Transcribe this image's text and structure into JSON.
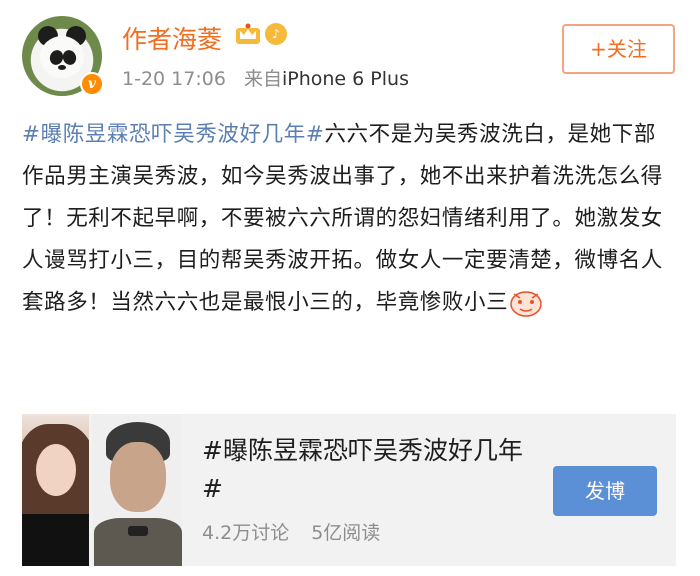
{
  "post": {
    "author": "作者海菱",
    "meta_time": "1-20 17:06",
    "meta_source_prefix": "来自",
    "meta_source": "iPhone 6 Plus",
    "follow_label": "+关注",
    "hashtag": "#曝陈昱霖恐吓吴秀波好几年#",
    "body": "六六不是为吴秀波洗白，是她下部作品男主演吴秀波，如今吴秀波出事了，她不出来护着洗洗怎么得了！无利不起早啊，不要被六六所谓的怨妇情绪利用了。她激发女人谩骂打小三，目的帮吴秀波开拓。做女人一定要清楚，微博名人套路多！当然六六也是最恨小三的，毕竟惨败小三"
  },
  "topic_card": {
    "title": "#曝陈昱霖恐吓吴秀波好几年#",
    "discussions": "4.2万讨论",
    "reads": "5亿阅读",
    "post_label": "发博"
  },
  "icons": {
    "verified": "v-badge-icon",
    "member": "crown-icon",
    "music": "music-badge-icon",
    "emoji": "emoji-icon"
  },
  "colors": {
    "name": "#f26d1f",
    "hashtag": "#5b7fb3",
    "post_button": "#5b8fd6"
  }
}
